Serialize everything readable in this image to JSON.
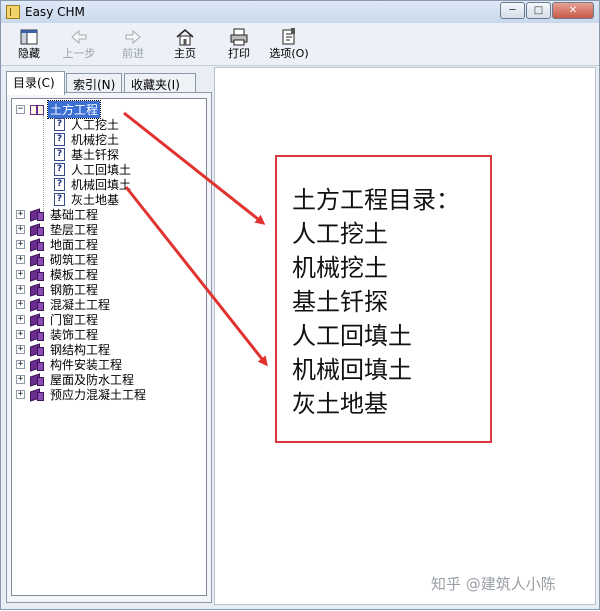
{
  "window": {
    "title": "Easy CHM"
  },
  "toolbar": {
    "hide": "隐藏",
    "back": "上一步",
    "forward": "前进",
    "home": "主页",
    "print": "打印",
    "options": "选项(O)"
  },
  "tabs": {
    "contents": "目录(C)",
    "index": "索引(N)",
    "favorites": "收藏夹(I)"
  },
  "tree": {
    "root": "土方工程",
    "children": [
      "人工挖土",
      "机械挖土",
      "基土钎探",
      "人工回填土",
      "机械回填土",
      "灰土地基"
    ],
    "siblings": [
      "基础工程",
      "垫层工程",
      "地面工程",
      "砌筑工程",
      "模板工程",
      "钢筋工程",
      "混凝土工程",
      "门窗工程",
      "装饰工程",
      "钢结构工程",
      "构件安装工程",
      "屋面及防水工程",
      "预应力混凝土工程"
    ]
  },
  "callout": {
    "lines": [
      "土方工程目录：",
      "人工挖土",
      "机械挖土",
      "基土钎探",
      "人工回填土",
      "机械回填土",
      "灰土地基"
    ]
  },
  "watermark": "知乎 @建筑人小陈",
  "colors": {
    "arrow": "#e0332f",
    "callout_border": "#d9383c",
    "selection": "#3b6fd4",
    "book": "#6a2c8e"
  }
}
